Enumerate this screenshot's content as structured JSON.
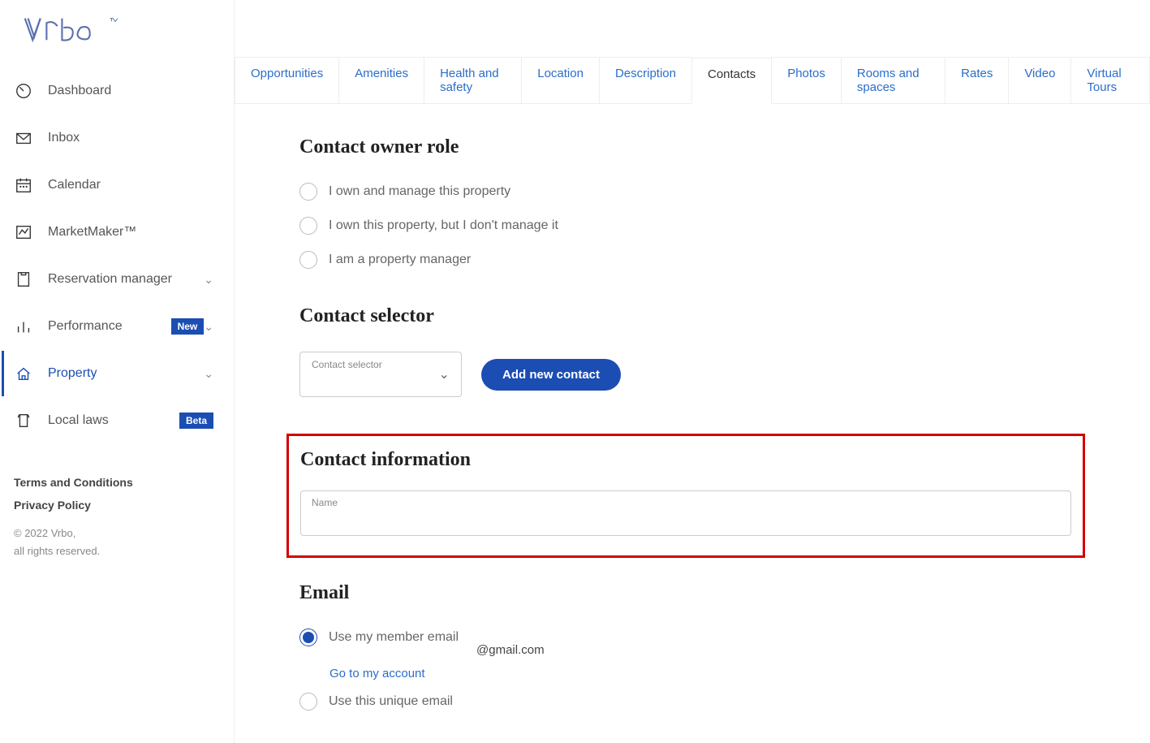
{
  "brand": "Vrbo",
  "sidebar": {
    "items": [
      {
        "label": "Dashboard",
        "icon": "dashboard"
      },
      {
        "label": "Inbox",
        "icon": "inbox"
      },
      {
        "label": "Calendar",
        "icon": "calendar"
      },
      {
        "label": "MarketMaker™",
        "icon": "market"
      },
      {
        "label": "Reservation manager",
        "icon": "reservation",
        "chev": true
      },
      {
        "label": "Performance",
        "icon": "performance",
        "badge": "New",
        "chev": true
      },
      {
        "label": "Property",
        "icon": "property",
        "chev": true,
        "active": true
      },
      {
        "label": "Local laws",
        "icon": "laws",
        "betaBadge": "Beta"
      }
    ],
    "terms": "Terms and Conditions",
    "privacy": "Privacy Policy",
    "copyright1": "© 2022 Vrbo,",
    "copyright2": "all rights reserved."
  },
  "tabs": [
    "Opportunities",
    "Amenities",
    "Health and safety",
    "Location",
    "Description",
    "Contacts",
    "Photos",
    "Rooms and spaces",
    "Rates",
    "Video",
    "Virtual Tours"
  ],
  "activeTab": "Contacts",
  "sections": {
    "ownerRole": {
      "title": "Contact owner role",
      "options": [
        "I own and manage this property",
        "I own this property, but I don't manage it",
        "I am a property manager"
      ]
    },
    "selector": {
      "title": "Contact selector",
      "dropdownLabel": "Contact selector",
      "addButton": "Add new contact"
    },
    "contactInfo": {
      "title": "Contact information",
      "nameLabel": "Name"
    },
    "email": {
      "title": "Email",
      "opt1": "Use my member email",
      "emailDomain": "@gmail.com",
      "accountLink": "Go to my account",
      "opt2": "Use this unique email"
    }
  }
}
